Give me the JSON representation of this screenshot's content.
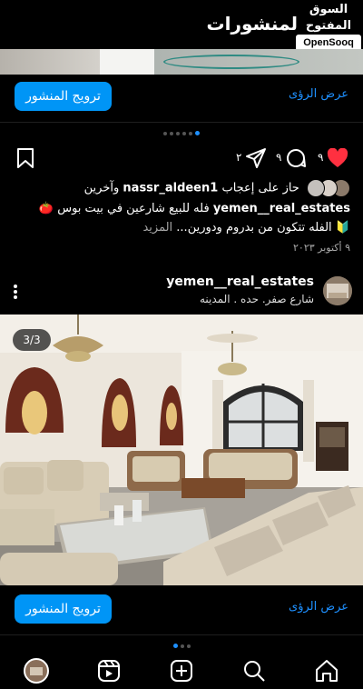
{
  "header": {
    "title": "لمنشورات"
  },
  "watermark": {
    "arabic": "السوق المفتوح",
    "english": "OpenSooq"
  },
  "post1": {
    "promote_label": "ترويج المنشور",
    "insights_label": "عرض الرؤى"
  },
  "actions": {
    "like_count": "٩",
    "comment_count": "٩",
    "share_count": "٢"
  },
  "likes": {
    "prefix": "حاز على إعجاب",
    "user": "nassr_aldeen1",
    "suffix": "وآخرين"
  },
  "caption": {
    "user": "yemen__real_estates",
    "text1": "فله للبيع شارعين في بيت بوس",
    "emoji1": "🍅",
    "emoji2": "🔰",
    "text2": "الفله تتكون من بدروم ودورين...",
    "more": "المزيد"
  },
  "date": "٩ أكتوبر ٢٠٢٣",
  "post2": {
    "username": "yemen__real_estates",
    "location": "شارع صفر. حده . المدينه",
    "counter": "3/3",
    "promote_label": "ترويج المنشور",
    "insights_label": "عرض الرؤى"
  },
  "colors": {
    "accent": "#0095f6",
    "link": "#1e90ff",
    "like": "#ff3040"
  },
  "nav": [
    "home-icon",
    "search-icon",
    "create-icon",
    "reels-icon",
    "profile-avatar"
  ]
}
